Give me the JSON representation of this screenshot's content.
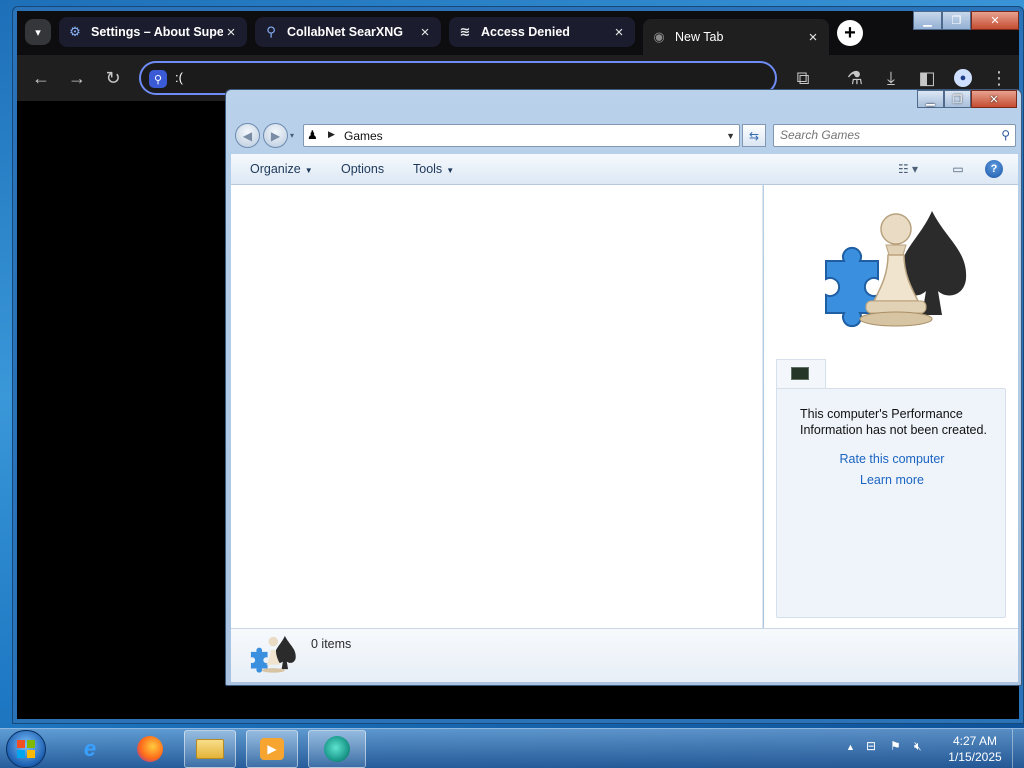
{
  "browser": {
    "tabs": [
      {
        "title": "Settings – About Supe",
        "icon": "gear-icon",
        "active": false
      },
      {
        "title": "CollabNet SearXNG",
        "icon": "search-icon",
        "active": false
      },
      {
        "title": "Access Denied",
        "icon": "stack-icon",
        "active": false
      },
      {
        "title": "New Tab",
        "icon": "globe-icon",
        "active": true
      }
    ],
    "omnibox_value": ":(",
    "new_tab_label": "+"
  },
  "explorer": {
    "breadcrumb": "Games",
    "search_placeholder": "Search Games",
    "commands": {
      "organize": "Organize",
      "options": "Options",
      "tools": "Tools"
    },
    "performance": {
      "message": "This computer's Performance Information has not been created.",
      "rate_link": "Rate this computer",
      "learn_link": "Learn more"
    },
    "status": "0 items"
  },
  "taskbar": {
    "time": "4:27 AM",
    "date": "1/15/2025",
    "apps": [
      "internet-explorer-icon",
      "firefox-icon",
      "explorer-folder-icon",
      "media-player-icon",
      "browser-app-icon"
    ]
  },
  "colors": {
    "accent": "#6f8cf5",
    "link": "#1b64c2"
  }
}
